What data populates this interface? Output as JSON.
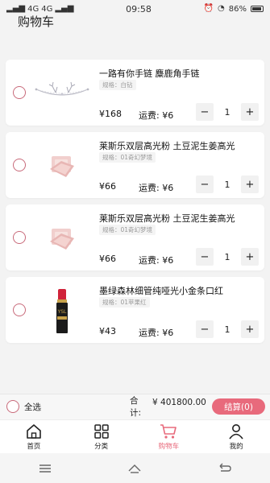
{
  "status_bar": {
    "signal_left": "4G",
    "signal_mid": "4G",
    "time": "09:58",
    "battery": "86%"
  },
  "header": {
    "title": "购物车"
  },
  "items": [
    {
      "name": "一路有你手链 麋鹿角手链",
      "spec": "规格：白钻",
      "price": "¥168",
      "shipping": "运费: ¥6",
      "quantity": "1",
      "image": "bracelet"
    },
    {
      "name": "莱斯乐双层高光粉 土豆泥生姜高光",
      "spec": "规格：01奇幻梦境",
      "price": "¥66",
      "shipping": "运费: ¥6",
      "quantity": "1",
      "image": "highlighter"
    },
    {
      "name": "莱斯乐双层高光粉 土豆泥生姜高光",
      "spec": "规格：01奇幻梦境",
      "price": "¥66",
      "shipping": "运费: ¥6",
      "quantity": "1",
      "image": "highlighter"
    },
    {
      "name": "墨绿森林细管纯哑光小金条口红",
      "spec": "规格：01苹果红",
      "price": "¥43",
      "shipping": "运费: ¥6",
      "quantity": "1",
      "image": "lipstick"
    }
  ],
  "stepper": {
    "minus": "−",
    "plus": "+"
  },
  "checkout": {
    "select_all": "全选",
    "total_label": "合计:",
    "total_amount": "¥ 401800.00",
    "checkout_button": "结算(0)"
  },
  "tabs": [
    {
      "label": "首页",
      "icon": "home-icon"
    },
    {
      "label": "分类",
      "icon": "grid-icon"
    },
    {
      "label": "购物车",
      "icon": "cart-icon",
      "active": true
    },
    {
      "label": "我的",
      "icon": "user-icon"
    }
  ],
  "colors": {
    "accent": "#e86a7c",
    "radio_border": "#c86a7a"
  }
}
